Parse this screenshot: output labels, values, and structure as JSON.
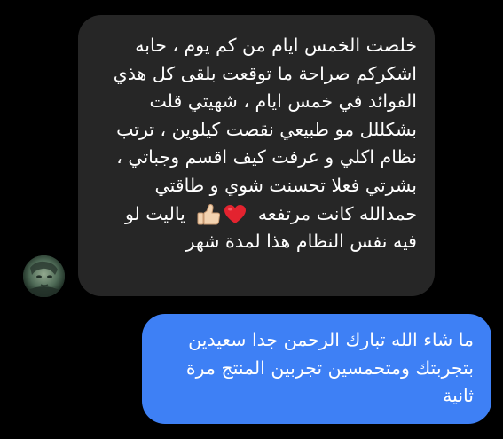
{
  "conversation": {
    "incoming": {
      "lines": [
        "خلصت الخمس ايام من كم يوم ، حابه",
        "اشكركم صراحة ما توقعت بلقى كل هذي",
        "الفوائد في خمس ايام ، شهيتي قلت",
        "بشكللل مو طبيعي نقصت كيلوين ، ترتب",
        "نظام اكلي و عرفت كيف اقسم وجباتي ،",
        "بشرتي فعلا تحسنت شوي و طاقتي"
      ],
      "line7_before_emoji": "حمدالله كانت مرتفعه",
      "line7_after_emoji": "ياليت لو",
      "line8": "فيه نفس النظام هذا لمدة شهر",
      "emojis": [
        "thumbs-up-icon",
        "red-heart-icon"
      ]
    },
    "outgoing": {
      "lines": [
        "ما شاء الله تبارك الرحمن جدا سعيدين",
        "بتجربتك ومتحمسين تجربين المنتج مرة",
        "ثانية"
      ]
    }
  },
  "colors": {
    "background": "#000000",
    "incoming_bubble": "#262626",
    "outgoing_bubble": "#3e80f5",
    "text": "#ffffff"
  }
}
